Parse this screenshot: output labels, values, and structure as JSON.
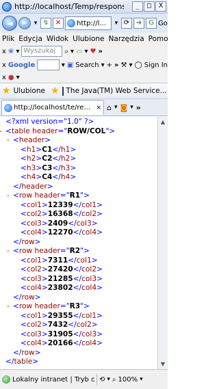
{
  "window": {
    "title": "http://localhost/Temp/responseTableX...",
    "minimize": "_",
    "maximize": "□",
    "close": "X"
  },
  "nav": {
    "address_text": "http://l...",
    "go_partial": "Go"
  },
  "menu": {
    "items": [
      "Plik",
      "Edycja",
      "Widok",
      "Ulubione",
      "Narzędzia",
      "Pomo"
    ],
    "more": "»"
  },
  "toolbar1": {
    "search_placeholder": "Wyszukaj",
    "more": "»"
  },
  "toolbar2": {
    "google_label": "Google",
    "search_label": "Search",
    "sign_in_label": "Sign In",
    "more": "»"
  },
  "favorites": {
    "label": "Ulubione",
    "link": "The Java(TM) Web Service...",
    "more": "»"
  },
  "tab": {
    "title": "http://localhost/te/re...",
    "close": "×"
  },
  "xml": {
    "declaration": "<?xml version=\"1.0\" ?>",
    "root_attr_name": "header",
    "root_attr_value": "ROW/COL",
    "header_values": [
      "C1",
      "C2",
      "C3",
      "C4"
    ],
    "rows": [
      {
        "header": "R1",
        "cols": [
          "12339",
          "16368",
          "2409",
          "12270"
        ]
      },
      {
        "header": "R2",
        "cols": [
          "7311",
          "27420",
          "21285",
          "23802"
        ]
      },
      {
        "header": "R3",
        "cols": [
          "29355",
          "7432",
          "31905",
          "20166"
        ]
      }
    ]
  },
  "status": {
    "zone": "Lokalny intranet | Tryb chroni",
    "zoom": "100%"
  }
}
